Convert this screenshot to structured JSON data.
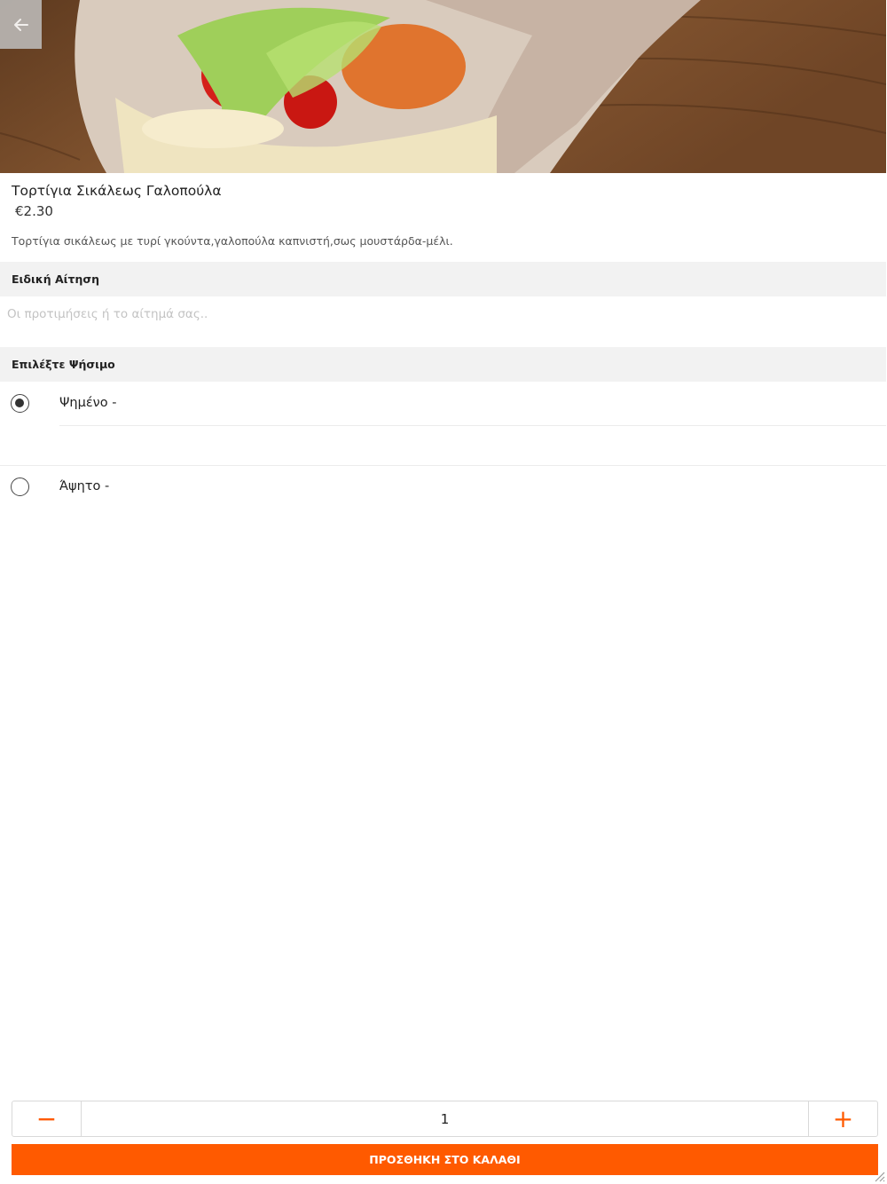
{
  "product": {
    "name": "Τορτίγια Σικάλεως Γαλοπούλα",
    "price": "€2.30",
    "description": "Τορτίγια σικάλεως με τυρί γκούντα,γαλοπούλα καπνιστή,σως μουστάρδα-μέλι."
  },
  "special_request": {
    "title": "Ειδική Αίτηση",
    "placeholder": "Οι προτιμήσεις ή το αίτημά σας..",
    "value": ""
  },
  "baking": {
    "title": "Επιλέξτε Ψήσιμο",
    "options": [
      {
        "label": "Ψημένο  -",
        "selected": true
      },
      {
        "label": "Άψητο  -",
        "selected": false
      }
    ]
  },
  "quantity": {
    "minus": "−",
    "value": "1",
    "plus": "+"
  },
  "add_to_cart_label": "ΠΡΟΣΘΗΚΗ ΣΤΟ ΚΑΛΑΘΙ",
  "colors": {
    "accent": "#ff5a00",
    "section_bg": "#f2f2f2"
  },
  "icons": {
    "back": "arrow-left-icon"
  }
}
